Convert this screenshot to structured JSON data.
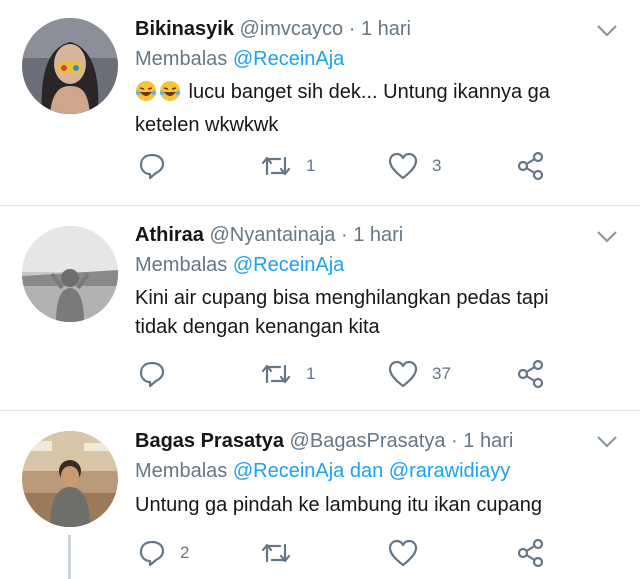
{
  "tweets": [
    {
      "name": "Bikinasyik",
      "handle": "@imvcayco",
      "separator": "·",
      "time": "1 hari",
      "reply_prefix": "Membalas",
      "reply_mentions": [
        "@ReceinAja"
      ],
      "reply_joiner": "",
      "emoji": "🤣🤣",
      "text_lines": [
        " lucu banget sih dek... Untung ikannya ga",
        "ketelen wkwkwk"
      ],
      "replies": "",
      "retweets": "1",
      "likes": "3"
    },
    {
      "name": "Athiraa",
      "handle": "@Nyantainaja",
      "separator": "·",
      "time": "1 hari",
      "reply_prefix": "Membalas",
      "reply_mentions": [
        "@ReceinAja"
      ],
      "reply_joiner": "",
      "emoji": "",
      "text_lines": [
        "Kini air cupang bisa menghilangkan pedas tapi",
        "tidak dengan kenangan kita"
      ],
      "replies": "",
      "retweets": "1",
      "likes": "37"
    },
    {
      "name": "Bagas Prasatya",
      "handle": "@BagasPrasatya",
      "separator": "·",
      "time": "1 hari",
      "reply_prefix": "Membalas",
      "reply_mentions": [
        "@ReceinAja",
        "@rarawidiayy"
      ],
      "reply_joiner": "dan",
      "emoji": "",
      "text_lines": [
        "Untung ga pindah ke lambung itu ikan cupang"
      ],
      "replies": "2",
      "retweets": "",
      "likes": ""
    }
  ],
  "icons": {
    "reply": "reply-icon",
    "retweet": "retweet-icon",
    "like": "heart-icon",
    "share": "share-icon",
    "menu": "chevron-down-icon"
  },
  "colors": {
    "mention": "#1da1f2",
    "muted": "#657786",
    "text": "#14171a",
    "divider": "#dfe3e7"
  }
}
